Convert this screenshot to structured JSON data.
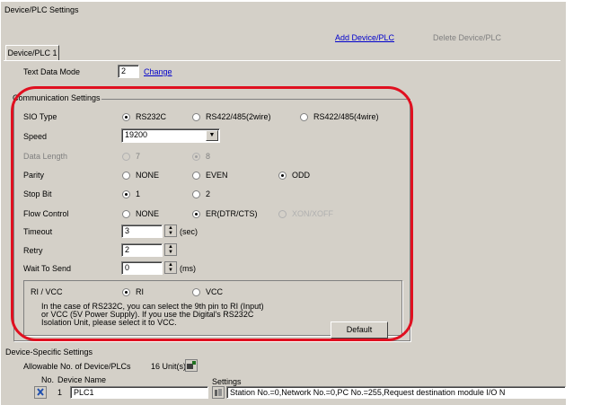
{
  "header": {
    "title": "Device/PLC Settings",
    "add_link": "Add Device/PLC",
    "delete_link": "Delete Device/PLC"
  },
  "tab": {
    "label": "Device/PLC 1"
  },
  "text_data_mode": {
    "label": "Text Data Mode",
    "value": "2",
    "change_link": "Change"
  },
  "comm": {
    "title": "Communication Settings",
    "sio_type": {
      "label": "SIO Type",
      "options": [
        "RS232C",
        "RS422/485(2wire)",
        "RS422/485(4wire)"
      ]
    },
    "speed": {
      "label": "Speed",
      "value": "19200"
    },
    "data_length": {
      "label": "Data Length",
      "options": [
        "7",
        "8"
      ]
    },
    "parity": {
      "label": "Parity",
      "options": [
        "NONE",
        "EVEN",
        "ODD"
      ]
    },
    "stop_bit": {
      "label": "Stop Bit",
      "options": [
        "1",
        "2"
      ]
    },
    "flow_control": {
      "label": "Flow Control",
      "options": [
        "NONE",
        "ER(DTR/CTS)",
        "XON/XOFF"
      ]
    },
    "timeout": {
      "label": "Timeout",
      "value": "3",
      "unit": "(sec)"
    },
    "retry": {
      "label": "Retry",
      "value": "2"
    },
    "wait_to_send": {
      "label": "Wait To Send",
      "value": "0",
      "unit": "(ms)"
    },
    "rivcc": {
      "label": "RI / VCC",
      "options": [
        "RI",
        "VCC"
      ],
      "note_line1": "In the case of RS232C, you can select the 9th pin to RI (Input)",
      "note_line2": "or VCC (5V Power Supply). If you use the Digital's RS232C",
      "note_line3": "Isolation Unit, please select it to VCC."
    },
    "default_button": "Default"
  },
  "device_specific": {
    "title": "Device-Specific Settings",
    "allowable_label": "Allowable No. of Device/PLCs",
    "allowable_value": "16 Unit(s)",
    "col_no": "No.",
    "col_device_name": "Device Name",
    "col_settings": "Settings",
    "rows": [
      {
        "no": "1",
        "name": "PLC1",
        "settings": "Station No.=0,Network No.=0,PC No.=255,Request destination module I/O N"
      }
    ]
  },
  "colors": {
    "panel": "#d4d0c8",
    "highlight_ring": "#e01020",
    "link": "#0000cc"
  }
}
